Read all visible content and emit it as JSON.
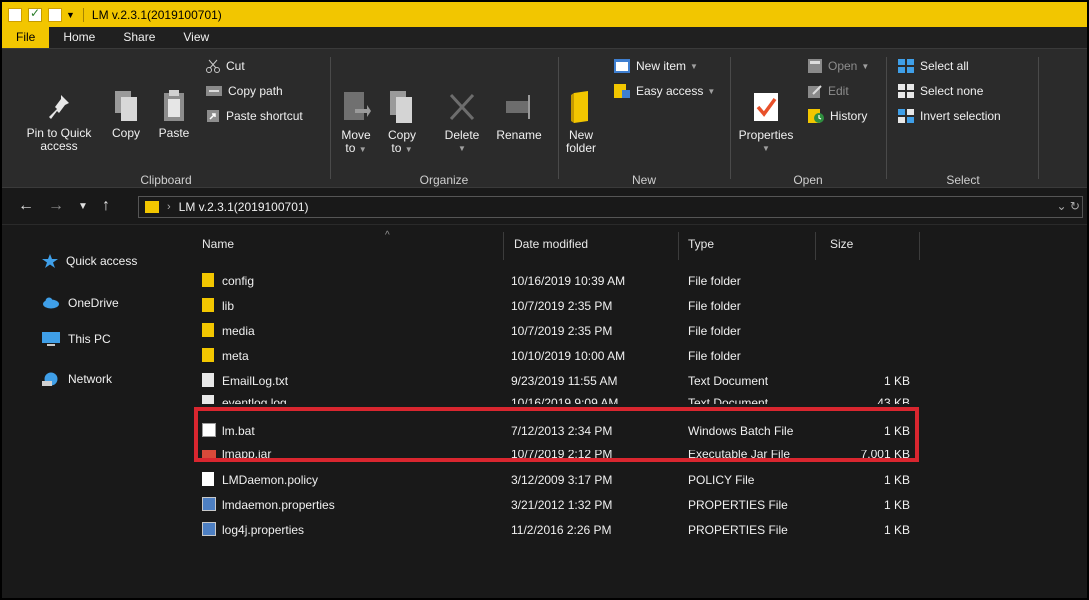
{
  "window": {
    "title": "LM v.2.3.1(2019100701)",
    "accent": "#f2c600",
    "highlight_color": "#d9262f"
  },
  "tabs": [
    {
      "label": "File"
    },
    {
      "label": "Home"
    },
    {
      "label": "Share"
    },
    {
      "label": "View"
    }
  ],
  "ribbon": {
    "clipboard": {
      "label": "Clipboard",
      "pin": "Pin to Quick access",
      "pin_line1": "Pin to Quick",
      "pin_line2": "access",
      "copy": "Copy",
      "paste": "Paste",
      "cut": "Cut",
      "copy_path": "Copy path",
      "paste_shortcut": "Paste shortcut"
    },
    "organize": {
      "label": "Organize",
      "move_to_line1": "Move",
      "move_to_line2": "to",
      "copy_to_line1": "Copy",
      "copy_to_line2": "to",
      "delete": "Delete",
      "rename": "Rename"
    },
    "new": {
      "label": "New",
      "new_folder_line1": "New",
      "new_folder_line2": "folder",
      "new_item": "New item",
      "easy_access": "Easy access"
    },
    "open": {
      "label": "Open",
      "properties": "Properties",
      "open": "Open",
      "edit": "Edit",
      "history": "History"
    },
    "select": {
      "label": "Select",
      "select_all": "Select all",
      "select_none": "Select none",
      "invert_selection": "Invert selection"
    }
  },
  "address": {
    "path": "LM v.2.3.1(2019100701)"
  },
  "nav_pane": [
    {
      "label": "Quick access",
      "icon": "star-icon"
    },
    {
      "label": "OneDrive",
      "icon": "cloud-icon"
    },
    {
      "label": "This PC",
      "icon": "pc-icon"
    },
    {
      "label": "Network",
      "icon": "network-icon"
    }
  ],
  "columns": {
    "name": "Name",
    "date": "Date modified",
    "type": "Type",
    "size": "Size"
  },
  "files": [
    {
      "name": "config",
      "date": "10/16/2019 10:39 AM",
      "type": "File folder",
      "size": "",
      "icon": "folder"
    },
    {
      "name": "lib",
      "date": "10/7/2019 2:35 PM",
      "type": "File folder",
      "size": "",
      "icon": "folder"
    },
    {
      "name": "media",
      "date": "10/7/2019 2:35 PM",
      "type": "File folder",
      "size": "",
      "icon": "folder"
    },
    {
      "name": "meta",
      "date": "10/10/2019 10:00 AM",
      "type": "File folder",
      "size": "",
      "icon": "folder"
    },
    {
      "name": "EmailLog.txt",
      "date": "9/23/2019 11:55 AM",
      "type": "Text Document",
      "size": "1 KB",
      "icon": "doc"
    },
    {
      "name": "eventlog.log",
      "date": "10/16/2019 9:09 AM",
      "type": "Text Document",
      "size": "43 KB",
      "icon": "doc"
    },
    {
      "name": "lm.bat",
      "date": "7/12/2013 2:34 PM",
      "type": "Windows Batch File",
      "size": "1 KB",
      "icon": "bat"
    },
    {
      "name": "lmapp.jar",
      "date": "10/7/2019 2:12 PM",
      "type": "Executable Jar File",
      "size": "7,001 KB",
      "icon": "jar"
    },
    {
      "name": "LMDaemon.policy",
      "date": "3/12/2009 3:17 PM",
      "type": "POLICY File",
      "size": "1 KB",
      "icon": "policy"
    },
    {
      "name": "lmdaemon.properties",
      "date": "3/21/2012 1:32 PM",
      "type": "PROPERTIES File",
      "size": "1 KB",
      "icon": "prop"
    },
    {
      "name": "log4j.properties",
      "date": "11/2/2016 2:26 PM",
      "type": "PROPERTIES File",
      "size": "1 KB",
      "icon": "prop"
    }
  ]
}
